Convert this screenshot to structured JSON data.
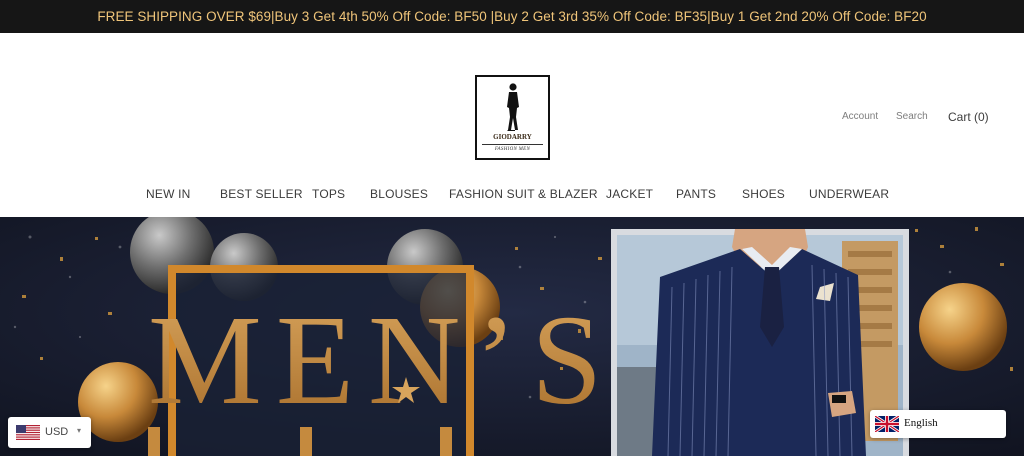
{
  "announcement": {
    "text": "FREE SHIPPING OVER $69|Buy 3 Get 4th 50% Off Code: BF50 |Buy 2 Get 3rd 35% Off Code: BF35|Buy 1 Get 2nd 20% Off Code: BF20"
  },
  "logo": {
    "brand": "GIODARRY",
    "tagline": "FASHION MEN"
  },
  "header": {
    "account_label": "Account",
    "search_label": "Search",
    "cart_label": "Cart (0)"
  },
  "nav": {
    "items": [
      {
        "label": "NEW IN"
      },
      {
        "label": "BEST SELLER"
      },
      {
        "label": "TOPS"
      },
      {
        "label": "BLOUSES"
      },
      {
        "label": "FASHION SUIT & BLAZER"
      },
      {
        "label": "JACKET"
      },
      {
        "label": "PANTS"
      },
      {
        "label": "SHOES"
      },
      {
        "label": "UNDERWEAR"
      }
    ]
  },
  "hero": {
    "headline": "MEN'S"
  },
  "currency": {
    "code": "USD",
    "flag_icon": "us-flag-icon"
  },
  "language": {
    "name": "English",
    "flag_icon": "uk-flag-icon"
  },
  "colors": {
    "announcement_bg": "#161616",
    "announcement_text": "#f0c57a",
    "hero_bg": "#15192a",
    "gold_accent": "#c8893a"
  }
}
